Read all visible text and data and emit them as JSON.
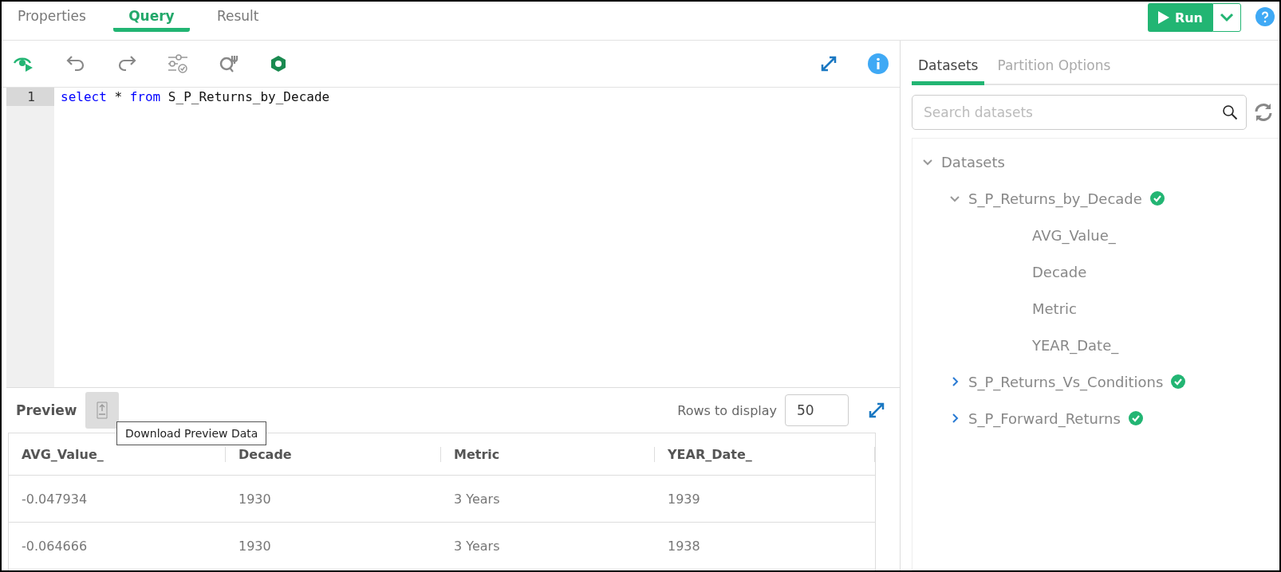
{
  "tabs": [
    {
      "label": "Properties",
      "selected": false
    },
    {
      "label": "Query",
      "selected": true
    },
    {
      "label": "Result",
      "selected": false
    }
  ],
  "run_button": {
    "label": "Run"
  },
  "editor": {
    "lines": [
      {
        "number": "1",
        "tokens": [
          {
            "text": "select",
            "kind": "keyword"
          },
          {
            "text": " * ",
            "kind": "plain"
          },
          {
            "text": "from",
            "kind": "keyword"
          },
          {
            "text": " S_P_Returns_by_Decade",
            "kind": "plain"
          }
        ]
      }
    ]
  },
  "preview": {
    "title": "Preview",
    "tooltip": "Download Preview Data",
    "rows_label": "Rows to display",
    "rows_value": "50",
    "columns": [
      "AVG_Value_",
      "Decade",
      "Metric",
      "YEAR_Date_"
    ],
    "rows": [
      [
        "-0.047934",
        "1930",
        "3 Years",
        "1939"
      ],
      [
        "-0.064666",
        "1930",
        "3 Years",
        "1938"
      ]
    ]
  },
  "side_tabs": [
    {
      "label": "Datasets",
      "selected": true
    },
    {
      "label": "Partition Options",
      "selected": false
    }
  ],
  "search": {
    "placeholder": "Search datasets"
  },
  "tree": [
    {
      "label": "Datasets",
      "kind": "folder",
      "expanded": true,
      "children": [
        {
          "label": "S_P_Returns_by_Decade",
          "kind": "dataset",
          "expanded": true,
          "children": [
            {
              "label": "AVG_Value_",
              "kind": "field"
            },
            {
              "label": "Decade",
              "kind": "field"
            },
            {
              "label": "Metric",
              "kind": "field"
            },
            {
              "label": "YEAR_Date_",
              "kind": "field"
            }
          ]
        },
        {
          "label": "S_P_Returns_Vs_Conditions",
          "kind": "dataset",
          "expanded": false
        },
        {
          "label": "S_P_Forward_Returns",
          "kind": "dataset",
          "expanded": false
        }
      ]
    }
  ]
}
